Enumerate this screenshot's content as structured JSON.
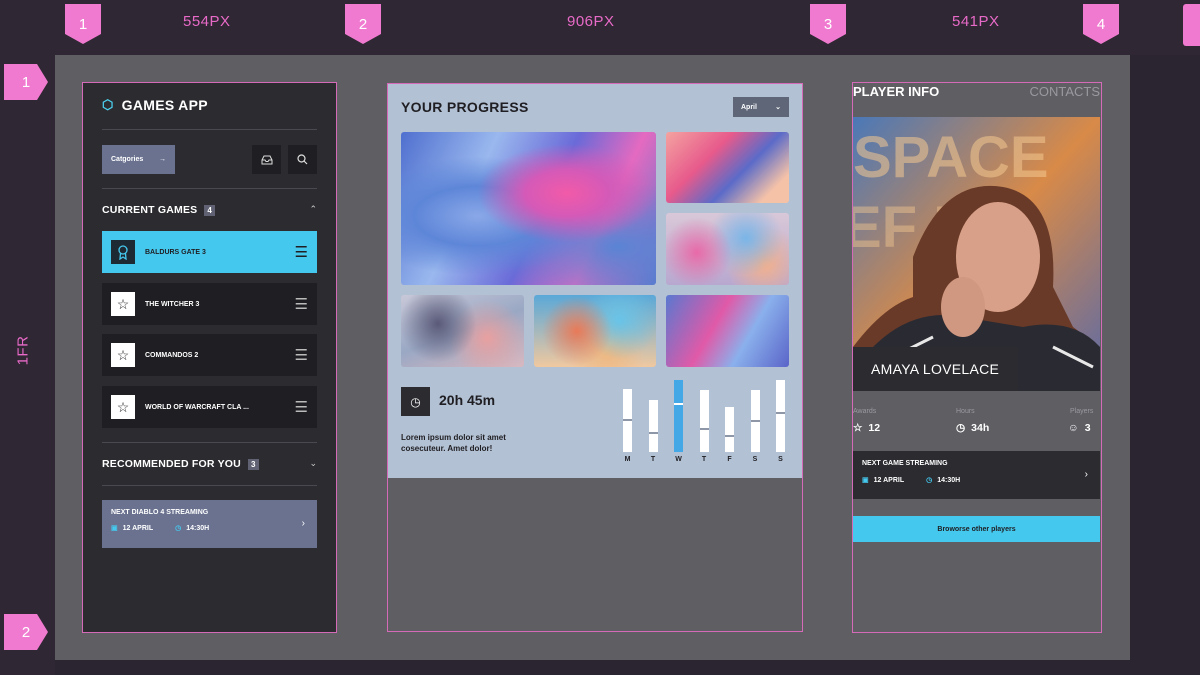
{
  "rulers": {
    "columns": [
      {
        "marker": "1",
        "label": "554PX"
      },
      {
        "marker": "2",
        "label": "906PX"
      },
      {
        "marker": "3",
        "label": "541PX"
      },
      {
        "marker": "4"
      }
    ],
    "rows": [
      {
        "marker": "1"
      },
      {
        "marker": "2"
      }
    ],
    "row_label": "1FR"
  },
  "left": {
    "app_title": "GAMES APP",
    "categories_button": "Catgories",
    "current_games": {
      "title": "CURRENT GAMES",
      "count": "4",
      "items": [
        {
          "name": "BALDURS GATE 3",
          "icon": "award-icon",
          "active": true
        },
        {
          "name": "THE WITCHER 3",
          "icon": "star-icon",
          "active": false
        },
        {
          "name": "COMMANDOS 2",
          "icon": "star-icon",
          "active": false
        },
        {
          "name": "WORLD OF WARCRAFT CLA ...",
          "icon": "star-icon",
          "active": false
        }
      ]
    },
    "recommended": {
      "title": "RECOMMENDED FOR YOU",
      "count": "3"
    },
    "stream": {
      "title": "NEXT DIABLO 4 STREAMING",
      "date": "12 APRIL",
      "time": "14:30H"
    }
  },
  "middle": {
    "title": "YOUR PROGRESS",
    "month": "April",
    "time_played": "20h 45m",
    "description": "Lorem ipsum dolor sit amet cosecuteur. Amet dolor!",
    "weekly_chart": {
      "days": [
        "M",
        "T",
        "W",
        "T",
        "F",
        "S",
        "S"
      ],
      "values": [
        0.88,
        0.72,
        1.0,
        0.86,
        0.62,
        0.86,
        1.0
      ],
      "marks": [
        0.52,
        0.38,
        0.68,
        0.38,
        0.38,
        0.52,
        0.55
      ],
      "highlight_index": 2
    }
  },
  "right": {
    "tab_active": "PLAYER INFO",
    "tab_inactive": "CONTACTS",
    "player_name": "AMAYA LOVELACE",
    "stats": [
      {
        "label": "Awards",
        "value": "12",
        "icon": "star-icon"
      },
      {
        "label": "Hours",
        "value": "34h",
        "icon": "clock-icon"
      },
      {
        "label": "Players",
        "value": "3",
        "icon": "user-icon"
      }
    ],
    "stream": {
      "title": "NEXT GAME STREAMING",
      "date": "12 APRIL",
      "time": "14:30H"
    },
    "browse_button": "Broworse other players"
  },
  "colors": {
    "accent": "#45c8ee",
    "guide": "#e86ac8",
    "panel": "#2c2b30",
    "progress_bg": "#b3c1d4"
  }
}
